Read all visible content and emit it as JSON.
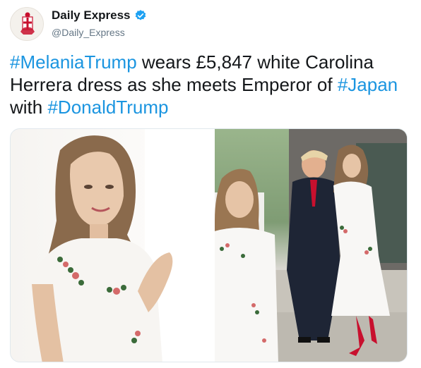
{
  "account": {
    "name": "Daily Express",
    "handle": "@Daily_Express",
    "avatar_icon": "daily-express-crusader-logo",
    "verified_icon": "verified-badge-icon",
    "verified_color": "#1da1f2"
  },
  "tweet": {
    "hashtag1": "#MelaniaTrump",
    "text1": " wears £5,847 white Carolina Herrera dress as she meets Emperor of ",
    "hashtag2": "#Japan",
    "text2": " with ",
    "hashtag3": "#DonaldTrump",
    "hashtag_color": "#1b95e0"
  },
  "media": {
    "image_icon": "photo-collage-melania-trump-white-dress"
  }
}
